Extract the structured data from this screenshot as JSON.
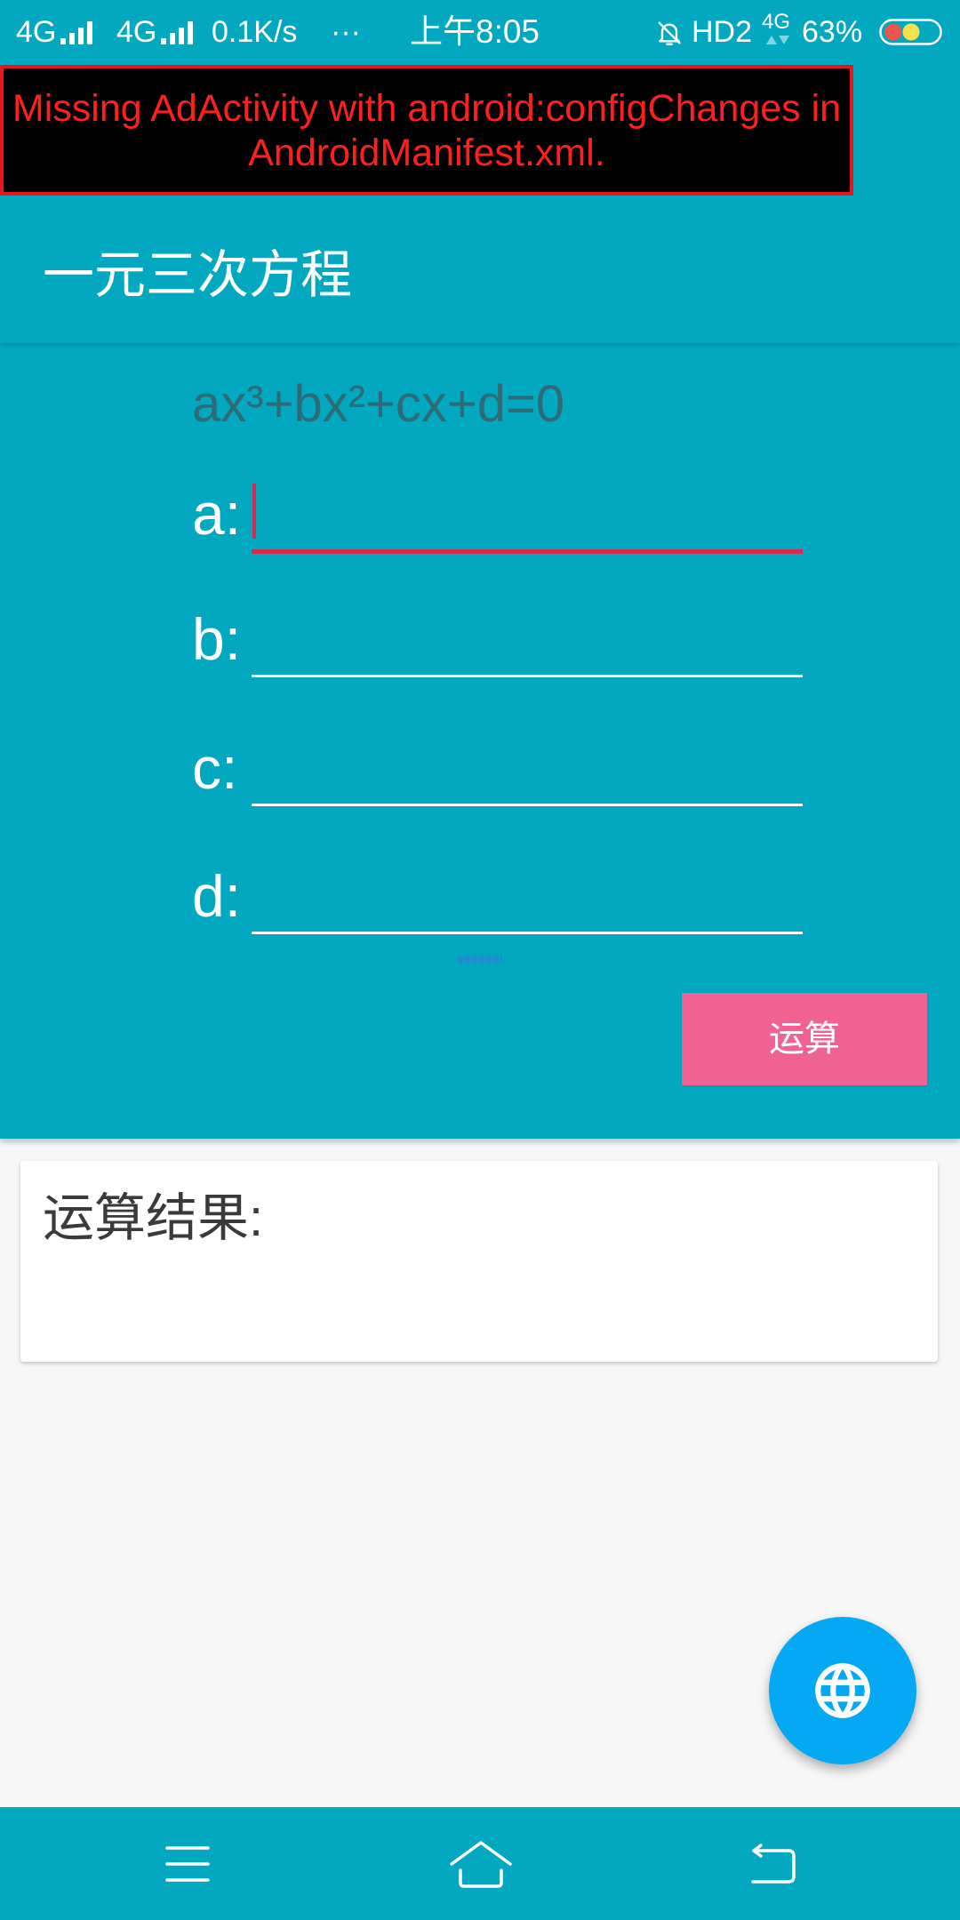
{
  "status_bar": {
    "sim1_network": "4G",
    "sim2_network": "4G",
    "net_speed": "0.1K/s",
    "overflow": "···",
    "time": "上午8:05",
    "hd_label": "HD2",
    "data_network": "4G",
    "battery_percent": "63%",
    "icons": {
      "signal": "signal-bars-icon",
      "notifications": "bell-off-icon",
      "data_activity": "data-arrows-icon",
      "battery": "battery-icon"
    }
  },
  "ad_error": {
    "line1": "Missing AdActivity with android:configChanges in",
    "line2": "AndroidManifest.xml."
  },
  "toolbar": {
    "title": "一元三次方程"
  },
  "form": {
    "equation": "ax³+bx²+cx+d=0",
    "fields": [
      {
        "label": "a:",
        "value": "",
        "focused": true
      },
      {
        "label": "b:",
        "value": ""
      },
      {
        "label": "c:",
        "value": ""
      },
      {
        "label": "d:",
        "value": ""
      }
    ],
    "submit_label": "运算"
  },
  "result": {
    "title": "运算结果:",
    "value": ""
  },
  "fab": {
    "icon": "globe-icon"
  },
  "nav_bar": {
    "buttons": [
      {
        "icon": "menu-icon"
      },
      {
        "icon": "home-icon"
      },
      {
        "icon": "back-icon"
      }
    ]
  },
  "colors": {
    "primary": "#02a8c0",
    "accent": "#d8294f",
    "button": "#f06292",
    "fab": "#05a8f2",
    "error_text": "#ff1f1f",
    "error_border": "#e8161b",
    "equation_text": "#2d6c76",
    "surface": "#f7f7f7"
  }
}
